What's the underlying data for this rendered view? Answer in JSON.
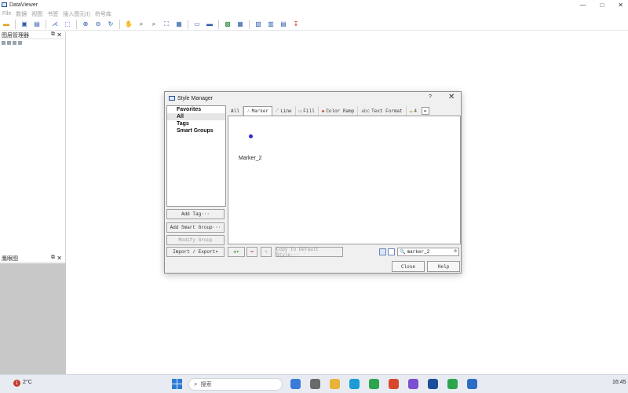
{
  "app": {
    "title": "DataViewer",
    "menu": [
      "File",
      "数据",
      "视图",
      "书签",
      "插入图元(I)",
      "符号库"
    ],
    "window_controls": [
      "—",
      "□",
      "✕"
    ]
  },
  "toolbar": {
    "icons": [
      "folder-open-icon",
      "save-icon",
      "save-as-icon",
      "vector-icon",
      "pointer-icon",
      "zoom-in-icon",
      "zoom-out-icon",
      "pan-icon",
      "zoom-icon",
      "zoom-extent-icon",
      "full-extent-icon",
      "refresh-icon",
      "identify-icon",
      "measure-icon",
      "table-icon",
      "map-icon",
      "layer-icon",
      "export-icon",
      "grid-icon",
      "chart-icon",
      "close-layer-icon"
    ]
  },
  "left_panels": {
    "top_title": "图层管理器",
    "bottom_title": "鹰眼图",
    "pin_glyph": "⧉",
    "close_glyph": "✕"
  },
  "dialog": {
    "title": "Style Manager",
    "help_glyph": "?",
    "close_glyph": "✕",
    "groups": [
      "Favorites",
      "All",
      "Tags",
      "Smart Groups"
    ],
    "selected_group": "All",
    "buttons": {
      "add_tag": "Add Tag···",
      "add_smart_group": "Add Smart Group···",
      "modify_group": "Modify Group"
    },
    "tabs": [
      {
        "label": "All",
        "icon": ""
      },
      {
        "label": "Marker",
        "icon": "∴"
      },
      {
        "label": "Line",
        "icon": "⟋"
      },
      {
        "label": "Fill",
        "icon": "▭"
      },
      {
        "label": "Color Ramp",
        "icon": "◆"
      },
      {
        "label": "Text Format",
        "icon": "abc"
      },
      {
        "label": "4",
        "icon": "▬"
      }
    ],
    "active_tab": "Marker",
    "tab_scroll_glyph": "▸",
    "preview_items": [
      {
        "label": "Marker_2",
        "color": "#2b2bd0"
      }
    ],
    "bottom": {
      "import_export": "Import / Export▾",
      "add_glyph": "✚▾",
      "remove_glyph": "━",
      "edit_glyph": "✎",
      "copy_default": "Copy to Default Style···",
      "search_value": "marker_2",
      "search_icon": "🔍",
      "clear_glyph": "⊗"
    },
    "close_button": "Close",
    "help_button": "Help"
  },
  "taskbar": {
    "weather_badge": "1",
    "temperature": "2°C",
    "search_text": "搜索",
    "clock": "16:45"
  }
}
